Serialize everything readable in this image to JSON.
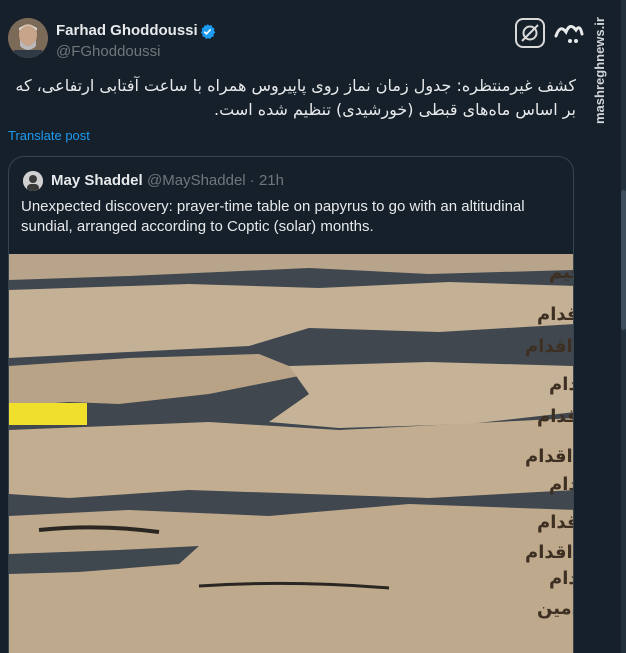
{
  "author": {
    "name": "Farhad Ghoddoussi",
    "handle": "@FGhoddoussi",
    "verified": true
  },
  "post": {
    "text_line1": "کشف غیرمنتظره: جدول زمان نماز روی پاپیروس همراه با ساعت آفتابی ارتفاعی، که",
    "text_line2": "بر اساس ماه‌های قبطی (خورشیدی) تنظیم شده است.",
    "translate_label": "Translate post"
  },
  "quote": {
    "name": "May Shaddel",
    "handle_time": "@MayShaddel · 21h",
    "text": "Unexpected discovery: prayer-time table on papyrus to go with an altitudinal sundial, arranged according to Coptic (solar) months."
  },
  "brand": {
    "logo_text": "مشرق",
    "watermark": "mashreghnews.ir"
  },
  "papyrus": {
    "lines": [
      "بسم الله الرحمن الرحيم",
      "توت الظهر سته اقدام",
      "بابه الظهر سبعه اقدام",
      "هتور الظهر سبعه اقدام",
      "كيهك الظهر ثمانيه اقدام",
      "طوبه الظهر سبعه اقدام",
      "امشير الظهر سته اقدام",
      "برمهات الظهر خمسه اقدام",
      "برموده الظهر اربعه اقدام",
      "بشنس الظهر ثلثه اقدام",
      "بونه الظهر قدمين"
    ]
  },
  "colors": {
    "accent": "#1d9bf0",
    "background": "#15202b",
    "border": "#38444d",
    "muted": "#71767b"
  }
}
